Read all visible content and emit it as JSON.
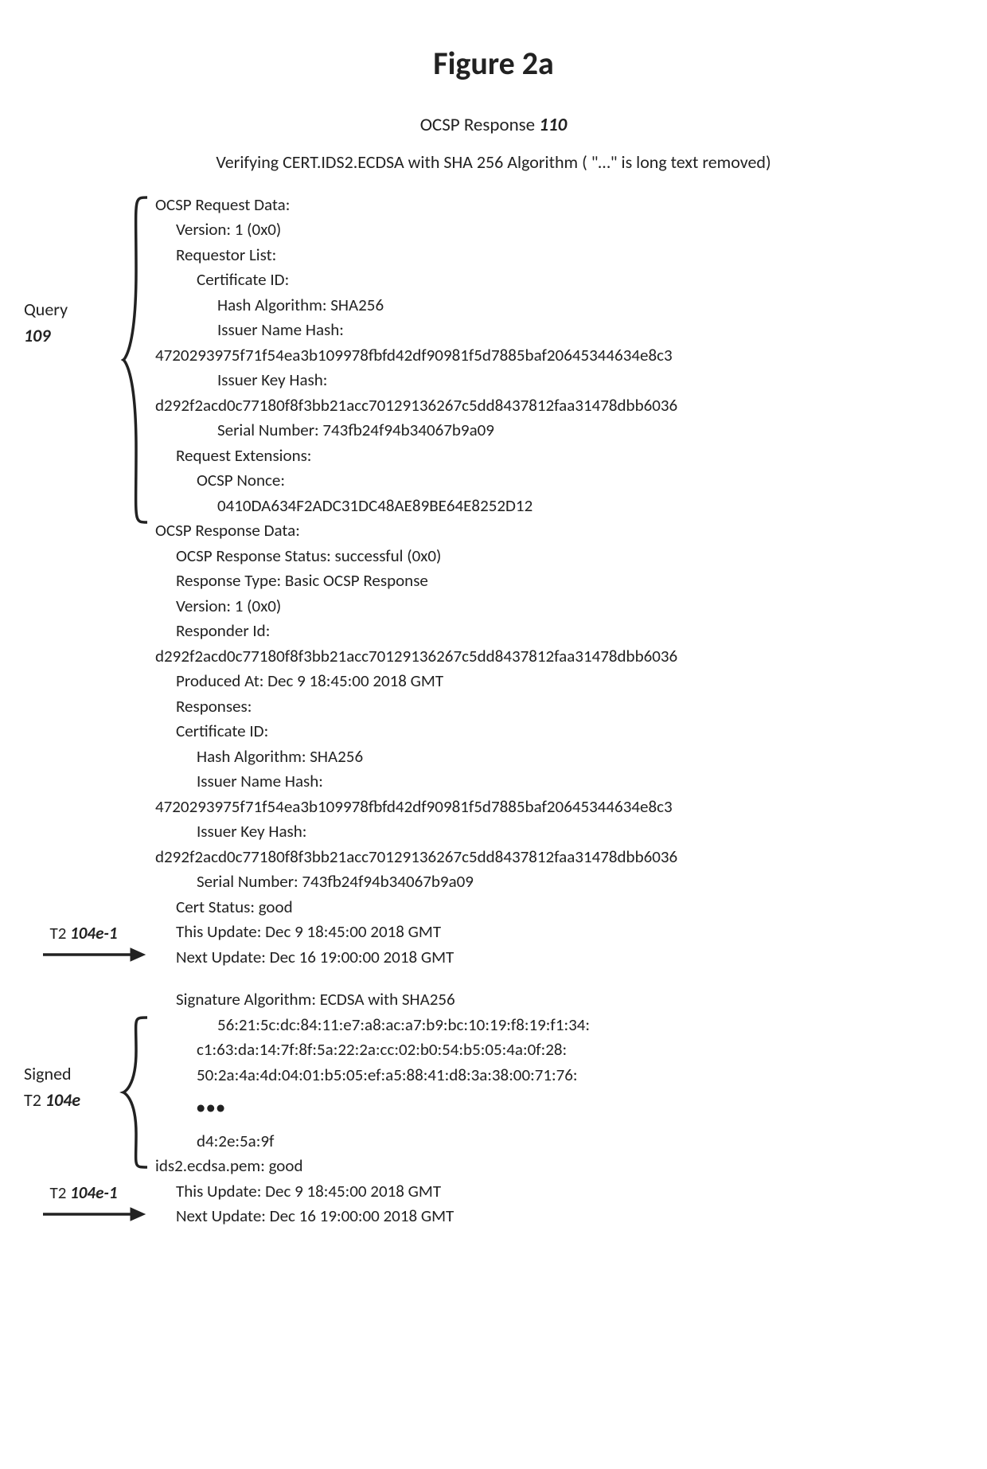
{
  "figure_title": "Figure 2a",
  "subtitle_prefix": "OCSP Response ",
  "subtitle_num": "110",
  "verifying_line": "Verifying CERT.IDS2.ECDSA with SHA 256 Algorithm  ( \"…\"  is long text removed)",
  "query_label_l1": "Query",
  "query_label_l2": "109",
  "request": {
    "header": "OCSP Request Data:",
    "version": "Version: 1 (0x0)",
    "requestor_list": "Requestor List:",
    "cert_id": "Certificate ID:",
    "hash_algo": "Hash Algorithm: SHA256",
    "issuer_name_hash_label": "Issuer Name Hash:",
    "issuer_name_hash_value": "4720293975f71f54ea3b109978fbfd42df90981f5d7885baf20645344634e8c3",
    "issuer_key_hash_label": "Issuer Key Hash:",
    "issuer_key_hash_value": "d292f2acd0c77180f8f3bb21acc70129136267c5dd8437812faa31478dbb6036",
    "serial_number": "Serial Number: 743fb24f94b34067b9a09",
    "request_extensions": "Request Extensions:",
    "ocsp_nonce_label": "OCSP Nonce:",
    "ocsp_nonce_value": "0410DA634F2ADC31DC48AE89BE64E8252D12"
  },
  "response": {
    "header": "OCSP Response Data:",
    "status": "OCSP Response Status: successful (0x0)",
    "type": "Response Type: Basic OCSP Response",
    "version": "Version: 1 (0x0)",
    "responder_id_label": "Responder Id:",
    "responder_id_value": "d292f2acd0c77180f8f3bb21acc70129136267c5dd8437812faa31478dbb6036",
    "produced_at": "Produced At: Dec  9 18:45:00 2018 GMT",
    "responses_label": "Responses:",
    "cert_id": "Certificate ID:",
    "hash_algo": "Hash Algorithm: SHA256",
    "issuer_name_hash_label": "Issuer Name Hash:",
    "issuer_name_hash_value": "4720293975f71f54ea3b109978fbfd42df90981f5d7885baf20645344634e8c3",
    "issuer_key_hash_label": "Issuer Key Hash:",
    "issuer_key_hash_value": "d292f2acd0c77180f8f3bb21acc70129136267c5dd8437812faa31478dbb6036",
    "serial_number": "Serial Number: 743fb24f94b34067b9a09",
    "cert_status": "Cert Status: good",
    "this_update": "This Update: Dec  9 18:45:00 2018 GMT",
    "next_update": "Next Update: Dec 16 19:00:00 2018 GMT"
  },
  "t2_label_prefix": "T2 ",
  "t2_label_num": "104e-1",
  "signed_label_l1": "Signed",
  "signed_label_l2a": "T2 ",
  "signed_label_l2b": "104e",
  "signature": {
    "algo": "Signature Algorithm: ECDSA with SHA256",
    "bytes_line1": "56:21:5c:dc:84:11:e7:a8:ac:a7:b9:bc:10:19:f8:19:f1:34:",
    "bytes_line2": "c1:63:da:14:7f:8f:5a:22:2a:cc:02:b0:54:b5:05:4a:0f:28:",
    "bytes_line3": "50:2a:4a:4d:04:01:b5:05:ef:a5:88:41:d8:3a:38:00:71:76:",
    "ellipsis": "•••",
    "bytes_end": "d4:2e:5a:9f"
  },
  "bottom": {
    "pem_status": "ids2.ecdsa.pem: good",
    "this_update": "This Update: Dec  9 18:45:00 2018 GMT",
    "next_update": "Next Update: Dec 16 19:00:00 2018 GMT"
  }
}
